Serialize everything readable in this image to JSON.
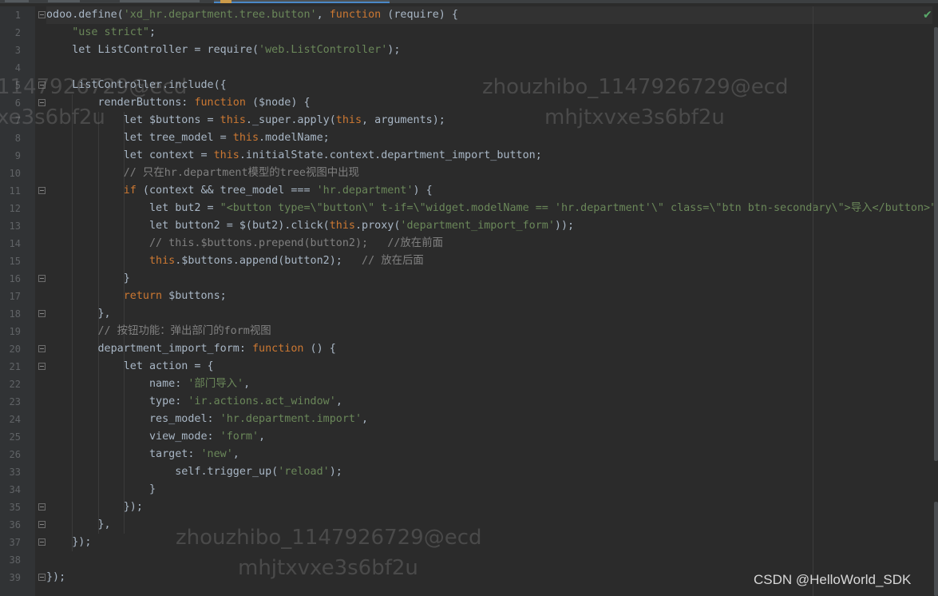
{
  "editor": {
    "status_icon": "check-icon",
    "lines": [
      {
        "n": "1",
        "tokens": [
          [
            "",
            "odoo.define("
          ],
          [
            "s",
            "'xd_hr.department.tree.button'"
          ],
          [
            "",
            ", "
          ],
          [
            "k",
            "function"
          ],
          [
            "",
            " (require) {"
          ]
        ]
      },
      {
        "n": "2",
        "tokens": [
          [
            "",
            "    "
          ],
          [
            "s",
            "\"use strict\""
          ],
          [
            "",
            ";"
          ]
        ]
      },
      {
        "n": "3",
        "tokens": [
          [
            "",
            "    let ListController = require("
          ],
          [
            "s",
            "'web.ListController'"
          ],
          [
            "",
            ");"
          ]
        ]
      },
      {
        "n": "4",
        "tokens": [
          [
            "",
            ""
          ]
        ]
      },
      {
        "n": "5",
        "tokens": [
          [
            "",
            "    ListController.include({"
          ]
        ]
      },
      {
        "n": "6",
        "tokens": [
          [
            "",
            "        renderButtons: "
          ],
          [
            "k",
            "function"
          ],
          [
            "",
            " ($node) {"
          ]
        ]
      },
      {
        "n": "7",
        "tokens": [
          [
            "",
            "            let $buttons = "
          ],
          [
            "k",
            "this"
          ],
          [
            "",
            "._super.apply("
          ],
          [
            "k",
            "this"
          ],
          [
            "",
            ", arguments);"
          ]
        ]
      },
      {
        "n": "8",
        "tokens": [
          [
            "",
            "            let tree_model = "
          ],
          [
            "k",
            "this"
          ],
          [
            "",
            ".modelName;"
          ]
        ]
      },
      {
        "n": "9",
        "tokens": [
          [
            "",
            "            let context = "
          ],
          [
            "k",
            "this"
          ],
          [
            "",
            ".initialState.context.department_import_button;"
          ]
        ]
      },
      {
        "n": "10",
        "tokens": [
          [
            "",
            "            "
          ],
          [
            "c",
            "// 只在hr.department模型的tree视图中出现"
          ]
        ]
      },
      {
        "n": "11",
        "tokens": [
          [
            "",
            "            "
          ],
          [
            "k",
            "if"
          ],
          [
            "",
            " (context && tree_model === "
          ],
          [
            "s",
            "'hr.department'"
          ],
          [
            "",
            ") {"
          ]
        ]
      },
      {
        "n": "12",
        "tokens": [
          [
            "",
            "                let but2 = "
          ],
          [
            "s",
            "\"<button type=\\\"button\\\" t-if=\\\"widget.modelName == 'hr.department'\\\" class=\\\"btn btn-secondary\\\">导入</button>\""
          ],
          [
            "",
            ";"
          ]
        ]
      },
      {
        "n": "13",
        "tokens": [
          [
            "",
            "                let button2 = $(but2).click("
          ],
          [
            "k",
            "this"
          ],
          [
            "",
            ".proxy("
          ],
          [
            "s",
            "'department_import_form'"
          ],
          [
            "",
            "));"
          ]
        ]
      },
      {
        "n": "14",
        "tokens": [
          [
            "",
            "                "
          ],
          [
            "c",
            "// this.$buttons.prepend(button2);   //放在前面"
          ]
        ]
      },
      {
        "n": "15",
        "tokens": [
          [
            "",
            "                "
          ],
          [
            "k",
            "this"
          ],
          [
            "",
            ".$buttons.append(button2);   "
          ],
          [
            "c",
            "// 放在后面"
          ]
        ]
      },
      {
        "n": "16",
        "tokens": [
          [
            "",
            "            }"
          ]
        ]
      },
      {
        "n": "17",
        "tokens": [
          [
            "",
            "            "
          ],
          [
            "k",
            "return"
          ],
          [
            "",
            " $buttons;"
          ]
        ]
      },
      {
        "n": "18",
        "tokens": [
          [
            "",
            "        },"
          ]
        ]
      },
      {
        "n": "19",
        "tokens": [
          [
            "",
            "        "
          ],
          [
            "c",
            "// 按钮功能：弹出部门的form视图"
          ]
        ]
      },
      {
        "n": "20",
        "tokens": [
          [
            "",
            "        department_import_form: "
          ],
          [
            "k",
            "function"
          ],
          [
            "",
            " () {"
          ]
        ]
      },
      {
        "n": "21",
        "tokens": [
          [
            "",
            "            let action = {"
          ]
        ]
      },
      {
        "n": "22",
        "tokens": [
          [
            "",
            "                name: "
          ],
          [
            "s",
            "'部门导入'"
          ],
          [
            "",
            ","
          ]
        ]
      },
      {
        "n": "23",
        "tokens": [
          [
            "",
            "                type: "
          ],
          [
            "s",
            "'ir.actions.act_window'"
          ],
          [
            "",
            ","
          ]
        ]
      },
      {
        "n": "24",
        "tokens": [
          [
            "",
            "                res_model: "
          ],
          [
            "s",
            "'hr.department.import'"
          ],
          [
            "",
            ","
          ]
        ]
      },
      {
        "n": "25",
        "tokens": [
          [
            "",
            "                view_mode: "
          ],
          [
            "s",
            "'form'"
          ],
          [
            "",
            ","
          ]
        ]
      },
      {
        "n": "26",
        "tokens": [
          [
            "",
            "                target: "
          ],
          [
            "s",
            "'new'"
          ],
          [
            "",
            ","
          ]
        ]
      },
      {
        "n": "33",
        "tokens": [
          [
            "",
            "                    self.trigger_up("
          ],
          [
            "s",
            "'reload'"
          ],
          [
            "",
            ");"
          ]
        ]
      },
      {
        "n": "34",
        "tokens": [
          [
            "",
            "                }"
          ]
        ]
      },
      {
        "n": "35",
        "tokens": [
          [
            "",
            "            });"
          ]
        ]
      },
      {
        "n": "36",
        "tokens": [
          [
            "",
            "        },"
          ]
        ]
      },
      {
        "n": "37",
        "tokens": [
          [
            "",
            "    });"
          ]
        ]
      },
      {
        "n": "38",
        "tokens": [
          [
            "",
            ""
          ]
        ]
      },
      {
        "n": "39",
        "tokens": [
          [
            "",
            "});"
          ]
        ]
      }
    ]
  },
  "watermarks": {
    "user_a": "zhouzhibo_1147926729@ecd",
    "user_b": "mhjtxvxe3s6bf2u",
    "left_a": "1147926729@ecd",
    "left_b": "xe3s6bf2u"
  },
  "credit": "CSDN @HelloWorld_SDK"
}
